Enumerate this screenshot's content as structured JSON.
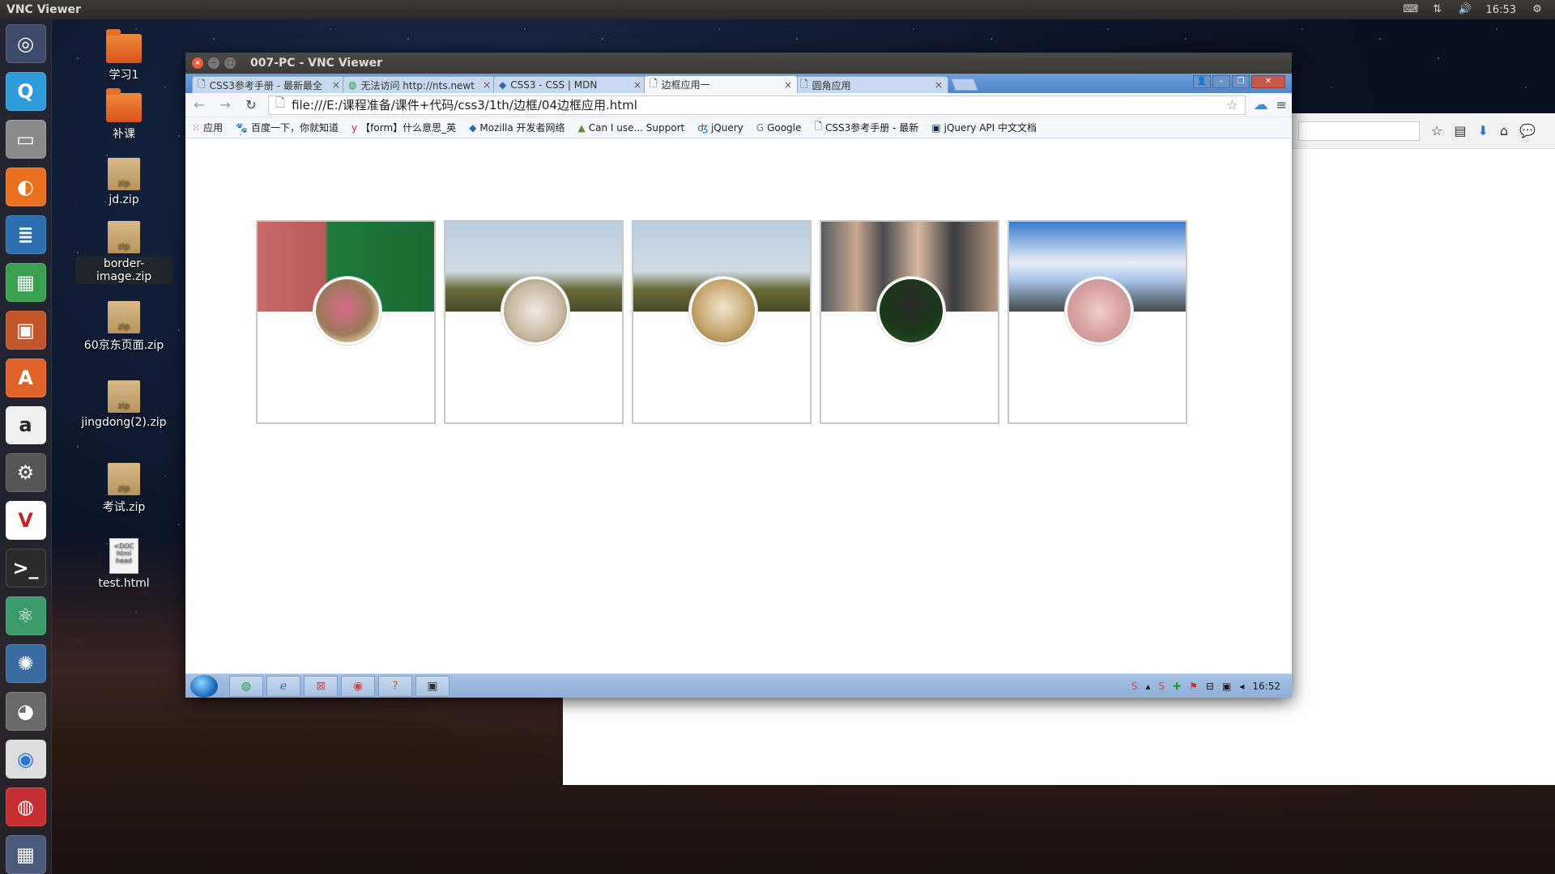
{
  "topbar": {
    "app_title": "VNC Viewer",
    "clock": "16:53"
  },
  "desktop": {
    "icons": [
      {
        "label": "学习1",
        "type": "folder"
      },
      {
        "label": "补课",
        "type": "folder"
      },
      {
        "label": "jd.zip",
        "type": "zip",
        "badge": "zip"
      },
      {
        "label": "border-image.zip",
        "type": "zip",
        "badge": "zip"
      },
      {
        "label": "60京东页面.zip",
        "type": "zip",
        "badge": "zip"
      },
      {
        "label": "jingdong(2).zip",
        "type": "zip",
        "badge": "zip"
      },
      {
        "label": "考试.zip",
        "type": "zip",
        "badge": "zip"
      },
      {
        "label": "test.html",
        "type": "html",
        "badge": "<DOC html head"
      }
    ]
  },
  "vnc": {
    "title": "007-PC - VNC Viewer"
  },
  "chrome": {
    "tabs": [
      {
        "label": "CSS3参考手册 - 最新最全",
        "icon": "doc-icon"
      },
      {
        "label": "无法访问 http://nts.newt",
        "icon": "globe-icon"
      },
      {
        "label": "CSS3 - CSS | MDN",
        "icon": "mdn-icon"
      },
      {
        "label": "边框应用一",
        "icon": "doc-icon"
      },
      {
        "label": "圆角应用",
        "icon": "doc-icon"
      }
    ],
    "active_tab": 3,
    "url": "file:///E:/课程准备/课件+代码/css3/1th/边框/04边框应用.html",
    "bookmarks": [
      {
        "label": "应用",
        "icon": "apps-grid-icon"
      },
      {
        "label": "百度一下，你就知道",
        "icon": "baidu-icon"
      },
      {
        "label": "【form】什么意思_英",
        "icon": "youdao-icon"
      },
      {
        "label": "Mozilla 开发者网络",
        "icon": "mdn-icon"
      },
      {
        "label": "Can I use... Support",
        "icon": "caniuse-icon"
      },
      {
        "label": "jQuery",
        "icon": "jquery-icon"
      },
      {
        "label": "Google",
        "icon": "google-icon"
      },
      {
        "label": "CSS3参考手册 - 最新",
        "icon": "doc-icon"
      },
      {
        "label": "jQuery API 中文文档",
        "icon": "jquery-api-icon"
      }
    ]
  },
  "page": {
    "cards": [
      {
        "name": "card-1",
        "banner": "green building with flower boxes",
        "avatar": "pink flowers"
      },
      {
        "name": "card-2",
        "banner": "red poppies against sky",
        "avatar": "white cat"
      },
      {
        "name": "card-3",
        "banner": "red poppies against sky",
        "avatar": "child in hay"
      },
      {
        "name": "card-4",
        "banner": "hooded figures",
        "avatar": "LUHAN 7 jersey"
      },
      {
        "name": "card-5",
        "banner": "road under blue sky with clouds",
        "avatar": "sleeping cat"
      }
    ]
  },
  "win_taskbar": {
    "clock": "16:52"
  },
  "colors": {
    "launcher_bg": "#2a2a30",
    "chrome_tab_bar": "#5b8fd2",
    "vnc_title_bar": "#3d3c38",
    "card_border": "#c8c8c8",
    "folder_orange": "#e3702c"
  }
}
